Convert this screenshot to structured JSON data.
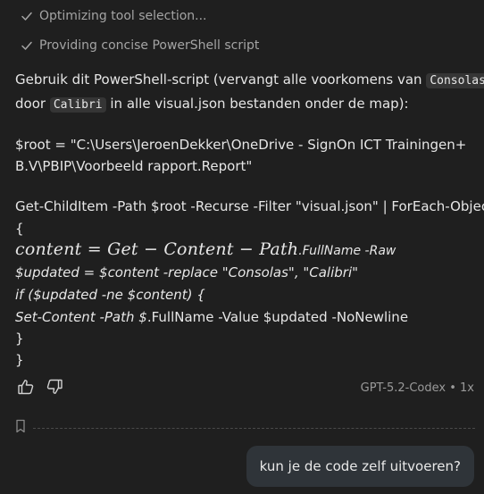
{
  "steps": [
    {
      "label": "Optimizing tool selection..."
    },
    {
      "label": "Providing concise PowerShell script"
    }
  ],
  "message": {
    "intro_part1": "Gebruik dit PowerShell-script (vervangt alle voorkomens van ",
    "intro_code1": "Consolas",
    "intro_part2": "door ",
    "intro_code2": "Calibri",
    "intro_part3": " in alle visual.json bestanden onder de map):",
    "root_line1": "$root = \"C:\\Users\\JeroenDekker\\OneDrive - SignOn ICT Trainingen+",
    "root_line2": "B.V\\PBIP\\Voorbeeld rapport.Report\"",
    "gci_line": "Get-ChildItem -Path $root -Recurse -Filter \"visual.json\" | ForEach-Object",
    "brace_open": "{",
    "math_part": "content = Get − Content − Path",
    "math_rest": ".FullName -Raw",
    "updated_line": "$updated = $content -replace \"Consolas\", \"Calibri\"",
    "if_line": "if ($updated -ne $content) {",
    "set_part1": "Set-Content -Path $",
    "set_part2": ".FullName -Value $updated -NoNewline",
    "brace_close1": "}",
    "brace_close2": "}"
  },
  "icons": {
    "check": "check-icon",
    "thumbs_up": "thumbs-up-icon",
    "thumbs_down": "thumbs-down-icon",
    "bookmark": "bookmark-icon"
  },
  "model_label": "GPT-5.2-Codex • 1x",
  "user_message": "kun je de code zelf uitvoeren?",
  "colors": {
    "background": "#1f1f1f",
    "text": "#e6e6e6",
    "muted": "#a4a4a4",
    "code_bg": "#353535",
    "bubble_bg": "#2f3439"
  }
}
